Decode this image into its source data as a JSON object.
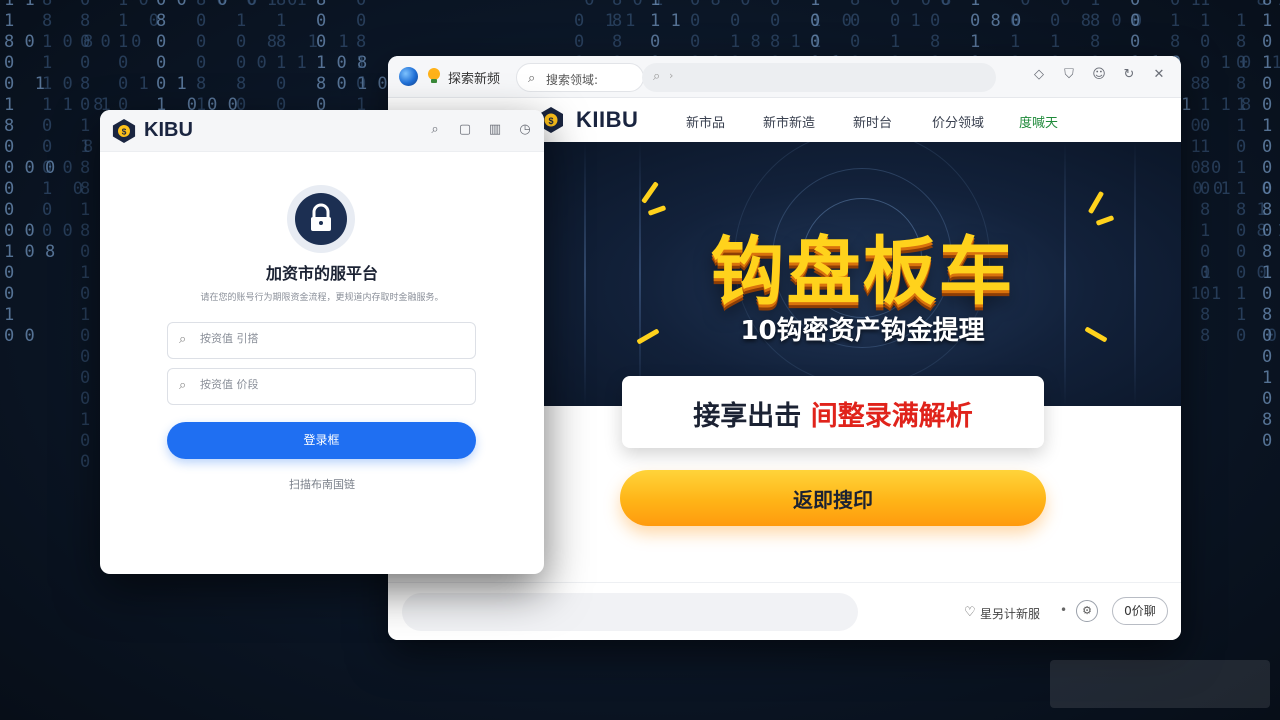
{
  "browser": {
    "tab_title": "探索新频",
    "tab_search_placeholder": "搜索领域:",
    "address_value": "",
    "site": {
      "logo_text": "KIIBU",
      "nav": [
        "新市品",
        "新市新造",
        "新时台",
        "价分领域",
        "度喊天"
      ]
    },
    "hero": {
      "title": "钩盘板车",
      "subtitle": "10钩密资产钩金提理"
    },
    "announce": {
      "text_main": "接享出击",
      "text_highlight": "间整录满解析"
    },
    "cta_label": "返即搜印",
    "footer": {
      "fav_label": "星另计新服",
      "pill_label": "0价聊"
    }
  },
  "login": {
    "logo_text": "KIBU",
    "title": "加资市的服平台",
    "description": "请在您的账号行为期限资金流程，更规道内存取时金融服务。",
    "username_placeholder": "按资值 引搭",
    "password_placeholder": "按资值 价段",
    "submit_label": "登录框",
    "link_label": "扫描布南国链"
  },
  "colors": {
    "primary_blue": "#1f6ff2",
    "accent_yellow": "#ffd21c",
    "accent_red": "#e0231b",
    "accent_green": "#1f8a3a",
    "bg_navy": "#0b1626"
  },
  "icons": {
    "browser_logo": "globe-icon",
    "search": "search-icon",
    "lock": "lock-icon",
    "close": "close-icon",
    "refresh": "refresh-icon",
    "favorite": "heart-icon"
  }
}
